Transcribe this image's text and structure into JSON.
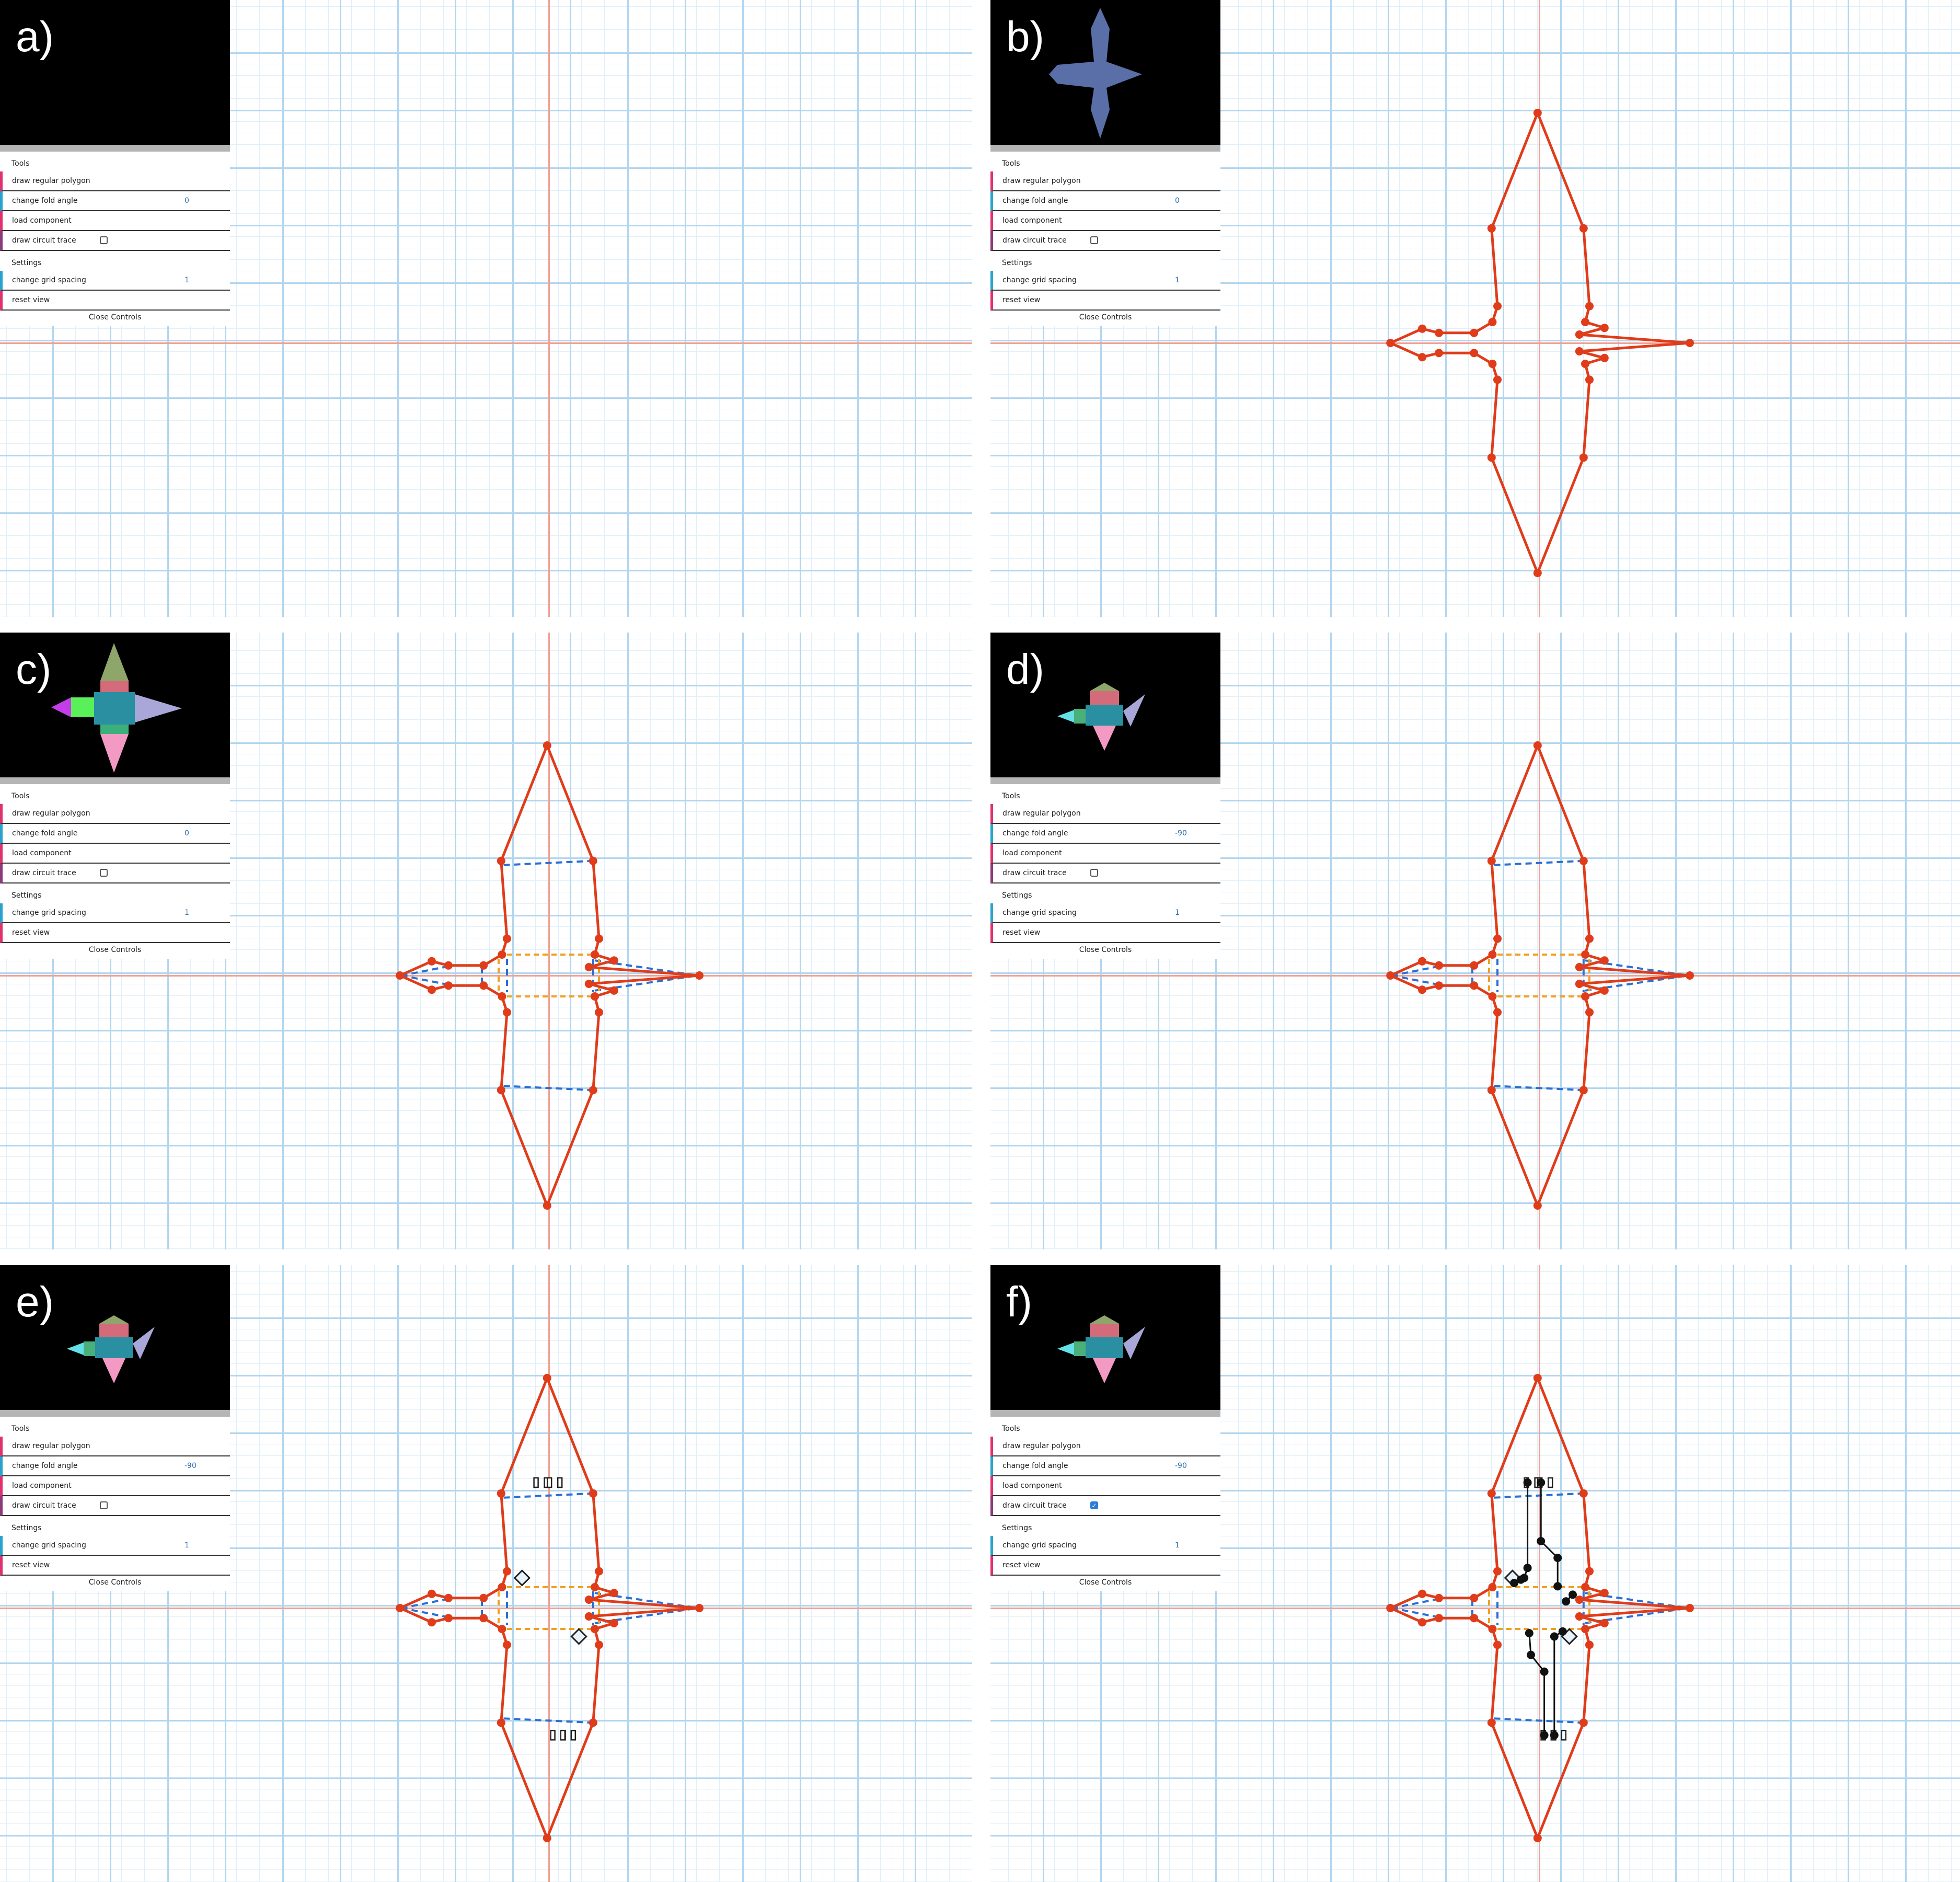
{
  "gui": {
    "tools_title": "Tools",
    "settings_title": "Settings",
    "draw_polygon_label": "draw regular polygon",
    "fold_angle_label": "change fold angle",
    "load_component_label": "load component",
    "circuit_trace_label": "draw circuit trace",
    "grid_spacing_label": "change grid spacing",
    "reset_view_label": "reset view",
    "close_label": "Close Controls"
  },
  "panels": [
    {
      "label": "a)",
      "fold_angle": "0",
      "grid_spacing": "1",
      "circuit_trace_checked": false,
      "shape": "none",
      "preview": "empty",
      "components": false,
      "traces": false
    },
    {
      "label": "b)",
      "fold_angle": "0",
      "grid_spacing": "1",
      "circuit_trace_checked": false,
      "shape": "outline",
      "preview": "flat",
      "components": false,
      "traces": false
    },
    {
      "label": "c)",
      "fold_angle": "0",
      "grid_spacing": "1",
      "circuit_trace_checked": false,
      "shape": "folds",
      "preview": "colored-flat",
      "components": false,
      "traces": false
    },
    {
      "label": "d)",
      "fold_angle": "-90",
      "grid_spacing": "1",
      "circuit_trace_checked": false,
      "shape": "folds",
      "preview": "folded",
      "components": false,
      "traces": false
    },
    {
      "label": "e)",
      "fold_angle": "-90",
      "grid_spacing": "1",
      "circuit_trace_checked": false,
      "shape": "folds",
      "preview": "folded",
      "components": true,
      "traces": false
    },
    {
      "label": "f)",
      "fold_angle": "-90",
      "grid_spacing": "1",
      "circuit_trace_checked": true,
      "shape": "folds",
      "preview": "folded",
      "components": true,
      "traces": true
    }
  ],
  "colors": {
    "outline": "#e03c1a",
    "fold_blue": "#2a6fd4",
    "fold_orange": "#f0a020",
    "axis": "#f2a093",
    "grid_major": "#b3d6ef",
    "grid_minor": "#e0eff9",
    "preview_flat": "#5a6fa8",
    "trace": "#111111"
  }
}
